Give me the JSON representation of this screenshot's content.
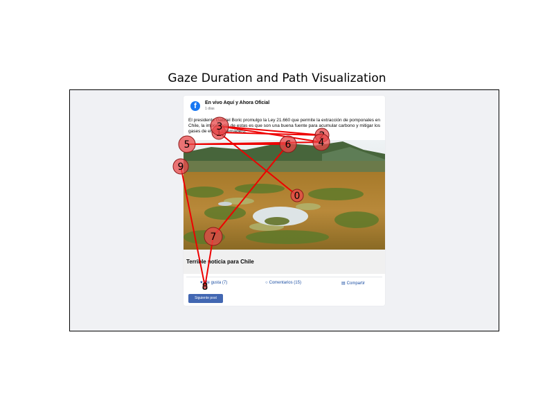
{
  "title": "Gaze Duration and Path Visualization",
  "post": {
    "page_name": "En vivo Aquí y Ahora Oficial",
    "time": "1 días",
    "text": "El presidente Gabriel Boric promulgo la Ley 21.660 que permite la extracción de pomponales en Chile, la importancia de estas es que son una buena fuente para acumular carbono y mitigar los gases de efecto invernadero.",
    "caption": "Terrible noticia para Chile",
    "actions": {
      "like": "Me gusta (7)",
      "comments": "Comentarios (15)",
      "share": "Compartir"
    },
    "next_button": "Siguiente post",
    "icons": {
      "logo": "facebook-icon",
      "like": "like-icon",
      "comment": "comment-icon",
      "share": "share-icon"
    }
  },
  "colors": {
    "fixation_fill": "#e8484a",
    "fixation_stroke": "#8b1a1a",
    "path": "#ee0000"
  },
  "chart_data": {
    "type": "scatter",
    "title": "Gaze Duration and Path Visualization",
    "xlabel": "",
    "ylabel": "",
    "axes_visible": false,
    "grid": false,
    "fixations": [
      {
        "label": "0",
        "size": 9,
        "path_index": 0
      },
      {
        "label": "1",
        "size": 10,
        "path_index": 1
      },
      {
        "label": "2",
        "size": 10,
        "path_index": 2
      },
      {
        "label": "3",
        "size": 13,
        "path_index": 3
      },
      {
        "label": "4",
        "size": 12,
        "path_index": 4
      },
      {
        "label": "5",
        "size": 12,
        "path_index": 5
      },
      {
        "label": "6",
        "size": 12,
        "path_index": 6
      },
      {
        "label": "7",
        "size": 13,
        "path_index": 7
      },
      {
        "label": "8",
        "size": 3,
        "path_index": 8
      },
      {
        "label": "9",
        "size": 11,
        "path_index": 9
      }
    ],
    "path_order": [
      "0",
      "1",
      "2",
      "3",
      "4",
      "5",
      "6",
      "7",
      "8",
      "9"
    ]
  }
}
